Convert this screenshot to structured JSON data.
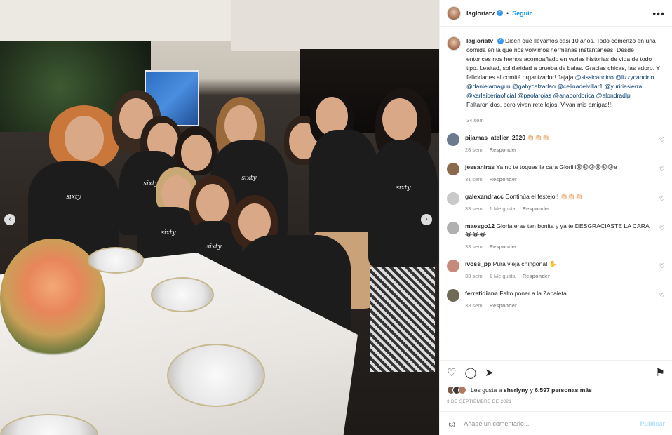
{
  "post": {
    "username": "lagloriatv",
    "follow_label": "Seguir",
    "more_icon": "more-options-icon",
    "dot": "•"
  },
  "photo": {
    "shirt_text": "sixty",
    "prev_arrow": "‹",
    "next_arrow": "›"
  },
  "caption": {
    "username": "lagloriatv",
    "text": "Dicen que llevamos casi 10 años. Todo comenzó en una comida en la que nos volvimos hermanas instantáneas. Desde entonces nos hemos acompañado en varias historias de vida de todo tipo. Lealtad, solidaridad a prueba de balas. Gracias chicas, las adoro. Y felicidades al comité organizador! Jajaja",
    "mentions": "@sissicancino @lizzycancino @danielamagun @gabycalzadao @celinadelvillar1 @yuririasierra @karlaiberiaoficial @paolarojas @anapordorica @alondradlp",
    "closing": "Faltaron dos, pero viven rete lejos. Vivan mis amigas!!!",
    "time": "34 sem"
  },
  "comments": [
    {
      "user": "pijamas_atelier_2020",
      "text": "👏🏻👏🏻👏🏻",
      "time": "28 sem",
      "likes": "",
      "reply": "Responder",
      "avatar_color": "#6b7a8f"
    },
    {
      "user": "jessaniras",
      "text": "Ya no te toques la cara Gloriiii😩😩😩😩😩😩e",
      "time": "31 sem",
      "likes": "",
      "reply": "Responder",
      "avatar_color": "#8a6a4a"
    },
    {
      "user": "galexandracc",
      "text": "Continúa el festejo!! 👏🏻👏🏻👏🏻",
      "time": "33 sem",
      "likes": "1 Me gusta",
      "reply": "Responder",
      "avatar_color": "#c9c9c9"
    },
    {
      "user": "maesgo12",
      "text": "Gloria eras tan bonita y ya te DESGRACIASTE LA CARA 😂😂😂",
      "time": "33 sem",
      "likes": "",
      "reply": "Responder",
      "avatar_color": "#b0b0b0"
    },
    {
      "user": "ivoss_pp",
      "text": "Pura vieja chingona! ✋",
      "time": "33 sem",
      "likes": "1 Me gusta",
      "reply": "Responder",
      "avatar_color": "#c48a7a"
    },
    {
      "user": "ferretidiana",
      "text": "Falto poner a la Zabaleta",
      "time": "33 sem",
      "likes": "",
      "reply": "Responder",
      "avatar_color": "#6f6a55"
    }
  ],
  "likes": {
    "prefix": "Les gusta a",
    "user": "sherlyny",
    "middle": "y",
    "count": "6.597 personas más"
  },
  "date": "3 DE SEPTIEMBRE DE 2021",
  "add_comment": {
    "placeholder": "Añade un comentario...",
    "publish_label": "Publicar"
  }
}
